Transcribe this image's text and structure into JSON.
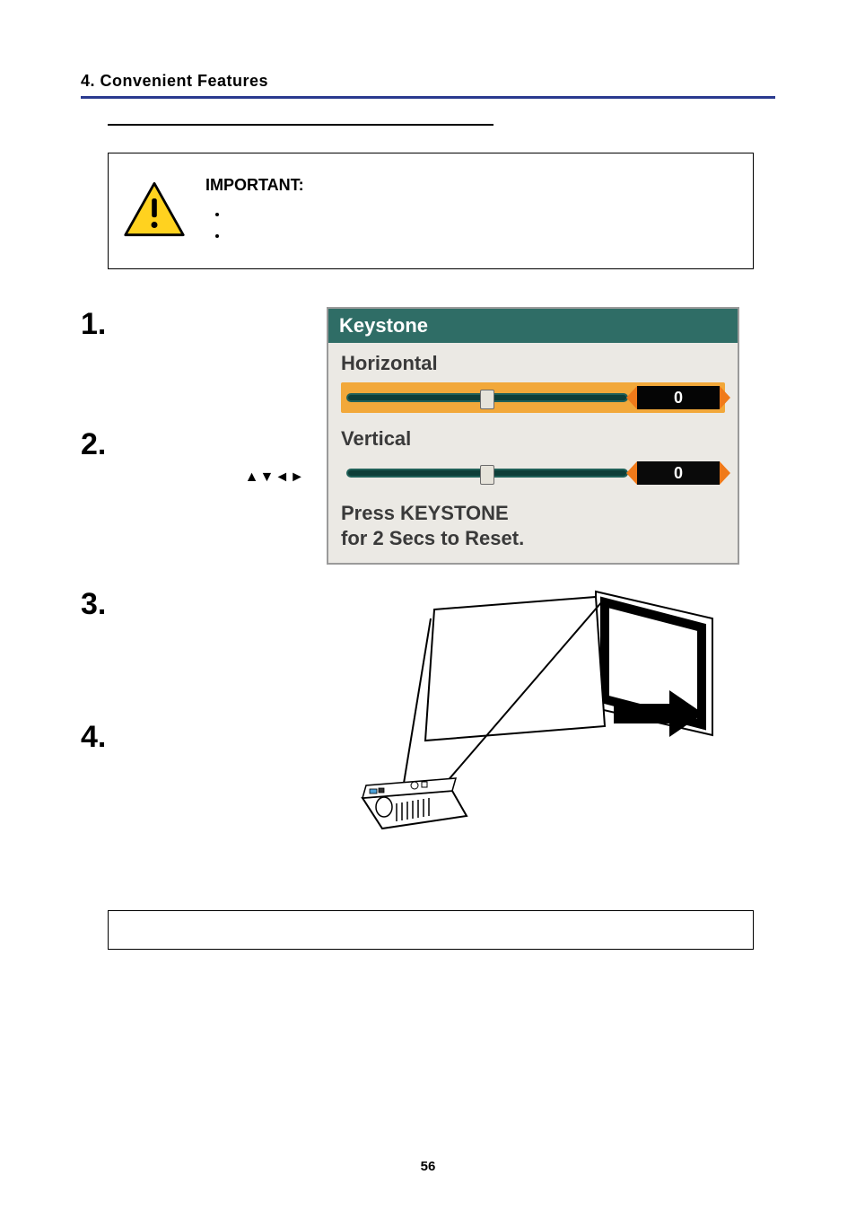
{
  "chapter": {
    "heading": "4. Convenient Features"
  },
  "section_line": true,
  "important": {
    "title": "IMPORTANT:",
    "bullets": [
      "",
      ""
    ]
  },
  "steps": {
    "items": [
      {
        "num": "1.",
        "body": "",
        "extra": ""
      },
      {
        "num": "2.",
        "body": "",
        "extra_arrows": "▲▼◄►"
      },
      {
        "num": "3.",
        "body": "",
        "extra": ""
      },
      {
        "num": "4.",
        "body": "",
        "extra": ""
      }
    ]
  },
  "keystone": {
    "title": "Keystone",
    "horizontal": {
      "label": "Horizontal",
      "value": "0"
    },
    "vertical": {
      "label": "Vertical",
      "value": "0"
    },
    "footer_line1": "Press KEYSTONE",
    "footer_line2": "for 2 Secs to Reset."
  },
  "note": {
    "text": ""
  },
  "page_number": "56"
}
